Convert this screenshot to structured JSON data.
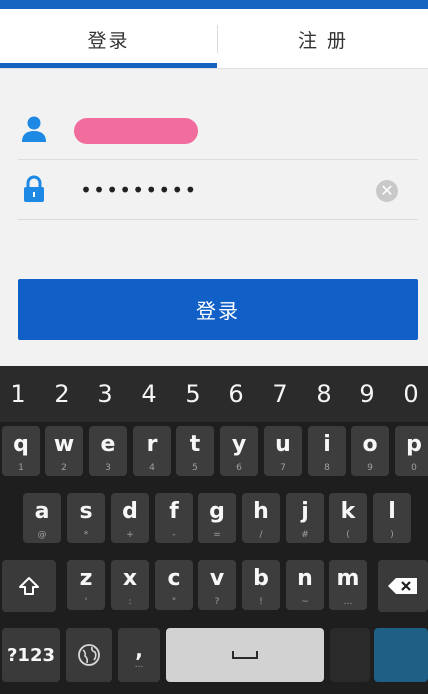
{
  "tabs": {
    "login": "登录",
    "register": "注 册"
  },
  "form": {
    "password_value": "•••••••••",
    "clear_glyph": "✕",
    "submit_label": "登录"
  },
  "keyboard": {
    "numbers": [
      "1",
      "2",
      "3",
      "4",
      "5",
      "6",
      "7",
      "8",
      "9",
      "0"
    ],
    "row1": [
      {
        "k": "q",
        "s": "1"
      },
      {
        "k": "w",
        "s": "2"
      },
      {
        "k": "e",
        "s": "3"
      },
      {
        "k": "r",
        "s": "4"
      },
      {
        "k": "t",
        "s": "5"
      },
      {
        "k": "y",
        "s": "6"
      },
      {
        "k": "u",
        "s": "7"
      },
      {
        "k": "i",
        "s": "8"
      },
      {
        "k": "o",
        "s": "9"
      },
      {
        "k": "p",
        "s": "0"
      }
    ],
    "row2": [
      {
        "k": "a",
        "s": "@"
      },
      {
        "k": "s",
        "s": "*"
      },
      {
        "k": "d",
        "s": "+"
      },
      {
        "k": "f",
        "s": "-"
      },
      {
        "k": "g",
        "s": "="
      },
      {
        "k": "h",
        "s": "/"
      },
      {
        "k": "j",
        "s": "#"
      },
      {
        "k": "k",
        "s": "("
      },
      {
        "k": "l",
        "s": ")"
      }
    ],
    "row3": [
      {
        "k": "z",
        "s": "'"
      },
      {
        "k": "x",
        "s": ":"
      },
      {
        "k": "c",
        "s": "\""
      },
      {
        "k": "v",
        "s": "?"
      },
      {
        "k": "b",
        "s": "!"
      },
      {
        "k": "n",
        "s": "~"
      },
      {
        "k": "m",
        "s": "…"
      }
    ],
    "symbols_label": "?123",
    "comma": ",",
    "comma_sub": "..."
  },
  "colors": {
    "accent": "#1565c0",
    "button": "#1060c8",
    "redaction": "#f06d9e",
    "keyboard_bg": "#1e1e1e"
  }
}
